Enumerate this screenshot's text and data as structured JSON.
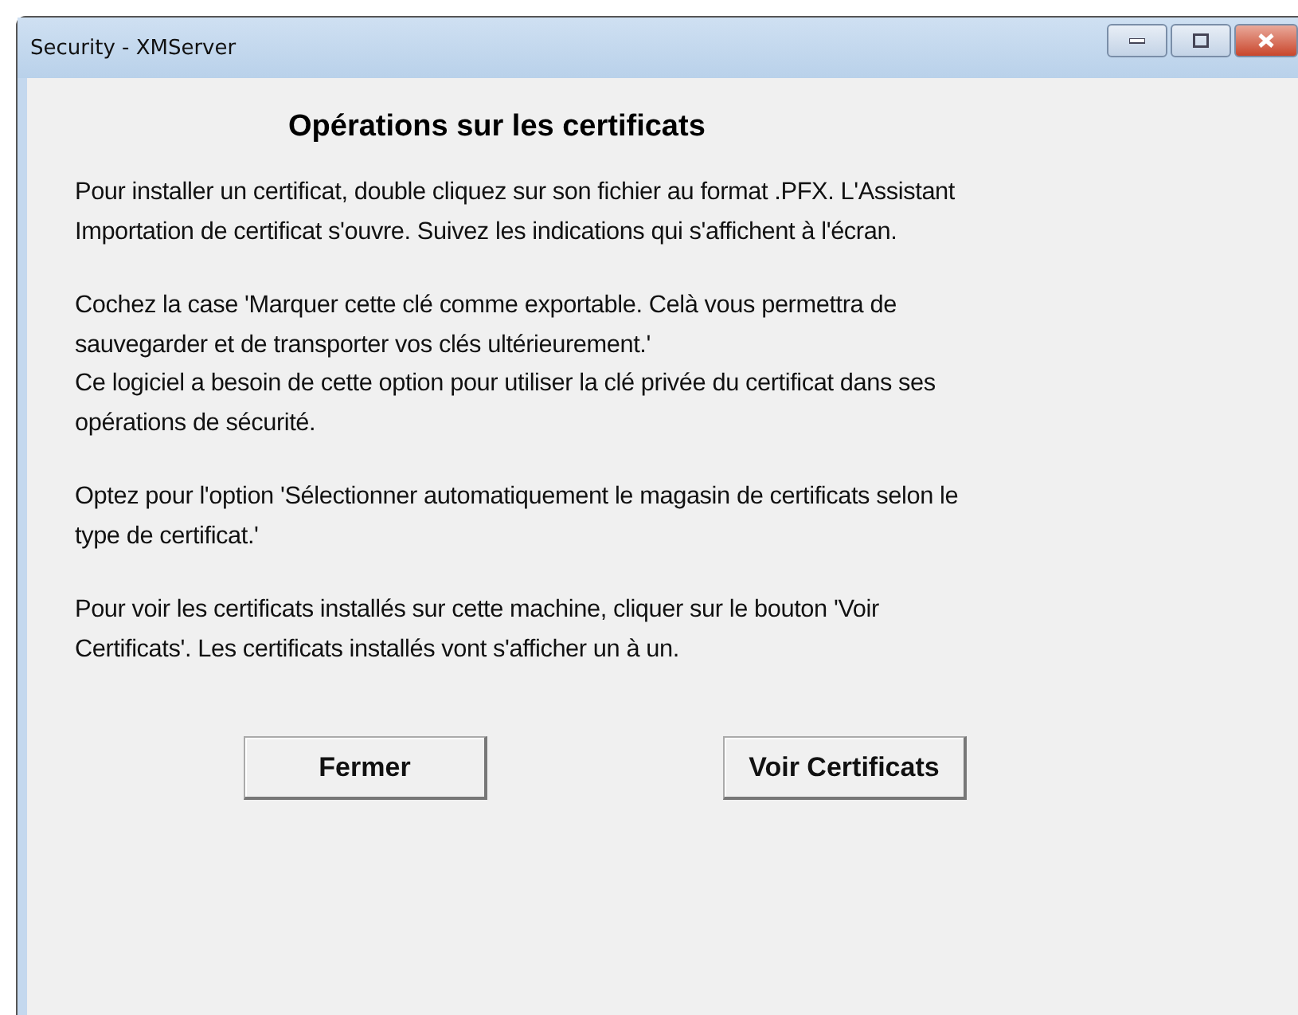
{
  "window": {
    "title": "Security - XMServer"
  },
  "heading": "Opérations sur les certificats",
  "sections": [
    [
      "Pour installer un certificat, double cliquez sur son fichier au format .PFX. L'Assistant\nImportation de certificat s'ouvre. Suivez les indications qui s'affichent à l'écran."
    ],
    [
      "Cochez la case 'Marquer cette clé comme exportable. Celà vous permettra de\nsauvegarder et de transporter vos clés ultérieurement.'",
      "Ce logiciel a besoin de cette option pour utiliser la clé privée du certificat dans ses\nopérations de sécurité."
    ],
    [
      "Optez pour l'option 'Sélectionner automatiquement le magasin de certificats selon le\ntype de certificat.'"
    ],
    [
      "Pour voir les certificats installés sur cette machine, cliquer sur le bouton 'Voir\nCertificats'. Les certificats installés vont s'afficher un à un."
    ]
  ],
  "buttons": [
    "Fermer",
    "Voir Certificats"
  ]
}
